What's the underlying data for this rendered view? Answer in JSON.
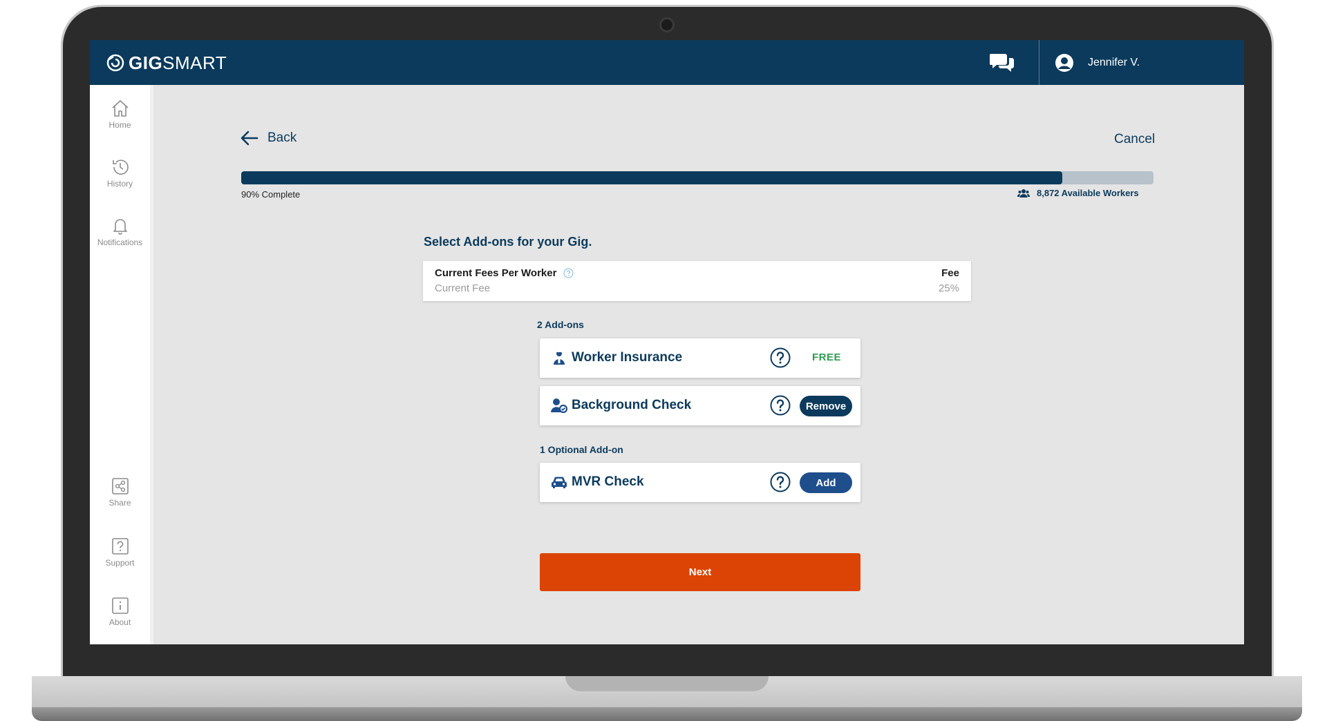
{
  "header": {
    "logo_gig": "GIG",
    "logo_smart": "SMART",
    "user_name": "Jennifer V."
  },
  "sidebar": {
    "items": [
      {
        "label": "Home",
        "icon": "home-icon"
      },
      {
        "label": "History",
        "icon": "history-icon"
      },
      {
        "label": "Notifications",
        "icon": "bell-icon"
      },
      {
        "label": "Share",
        "icon": "share-icon"
      },
      {
        "label": "Support",
        "icon": "question-icon"
      },
      {
        "label": "About",
        "icon": "info-icon"
      }
    ]
  },
  "nav": {
    "back_label": "Back",
    "cancel_label": "Cancel"
  },
  "progress": {
    "percent": 90,
    "label": "90% Complete",
    "workers_label": "8,872 Available Workers"
  },
  "page": {
    "title": "Select Add-ons for your Gig."
  },
  "fees": {
    "title": "Current Fees Per Worker",
    "subtitle": "Current Fee",
    "column_title": "Fee",
    "value": "25%"
  },
  "addons": {
    "selected_label": "2 Add-ons",
    "optional_label": "1 Optional Add-on",
    "items": [
      {
        "name": "Worker Insurance",
        "status": "FREE",
        "icon": "worker-insurance-icon"
      },
      {
        "name": "Background Check",
        "action": "Remove",
        "icon": "background-check-icon"
      },
      {
        "name": "MVR Check",
        "action": "Add",
        "icon": "car-icon"
      }
    ]
  },
  "footer": {
    "next_label": "Next"
  },
  "colors": {
    "brand_navy": "#0b3a5c",
    "accent_orange": "#dc4405",
    "free_green": "#2e9b52",
    "add_blue": "#1e4e8c"
  }
}
